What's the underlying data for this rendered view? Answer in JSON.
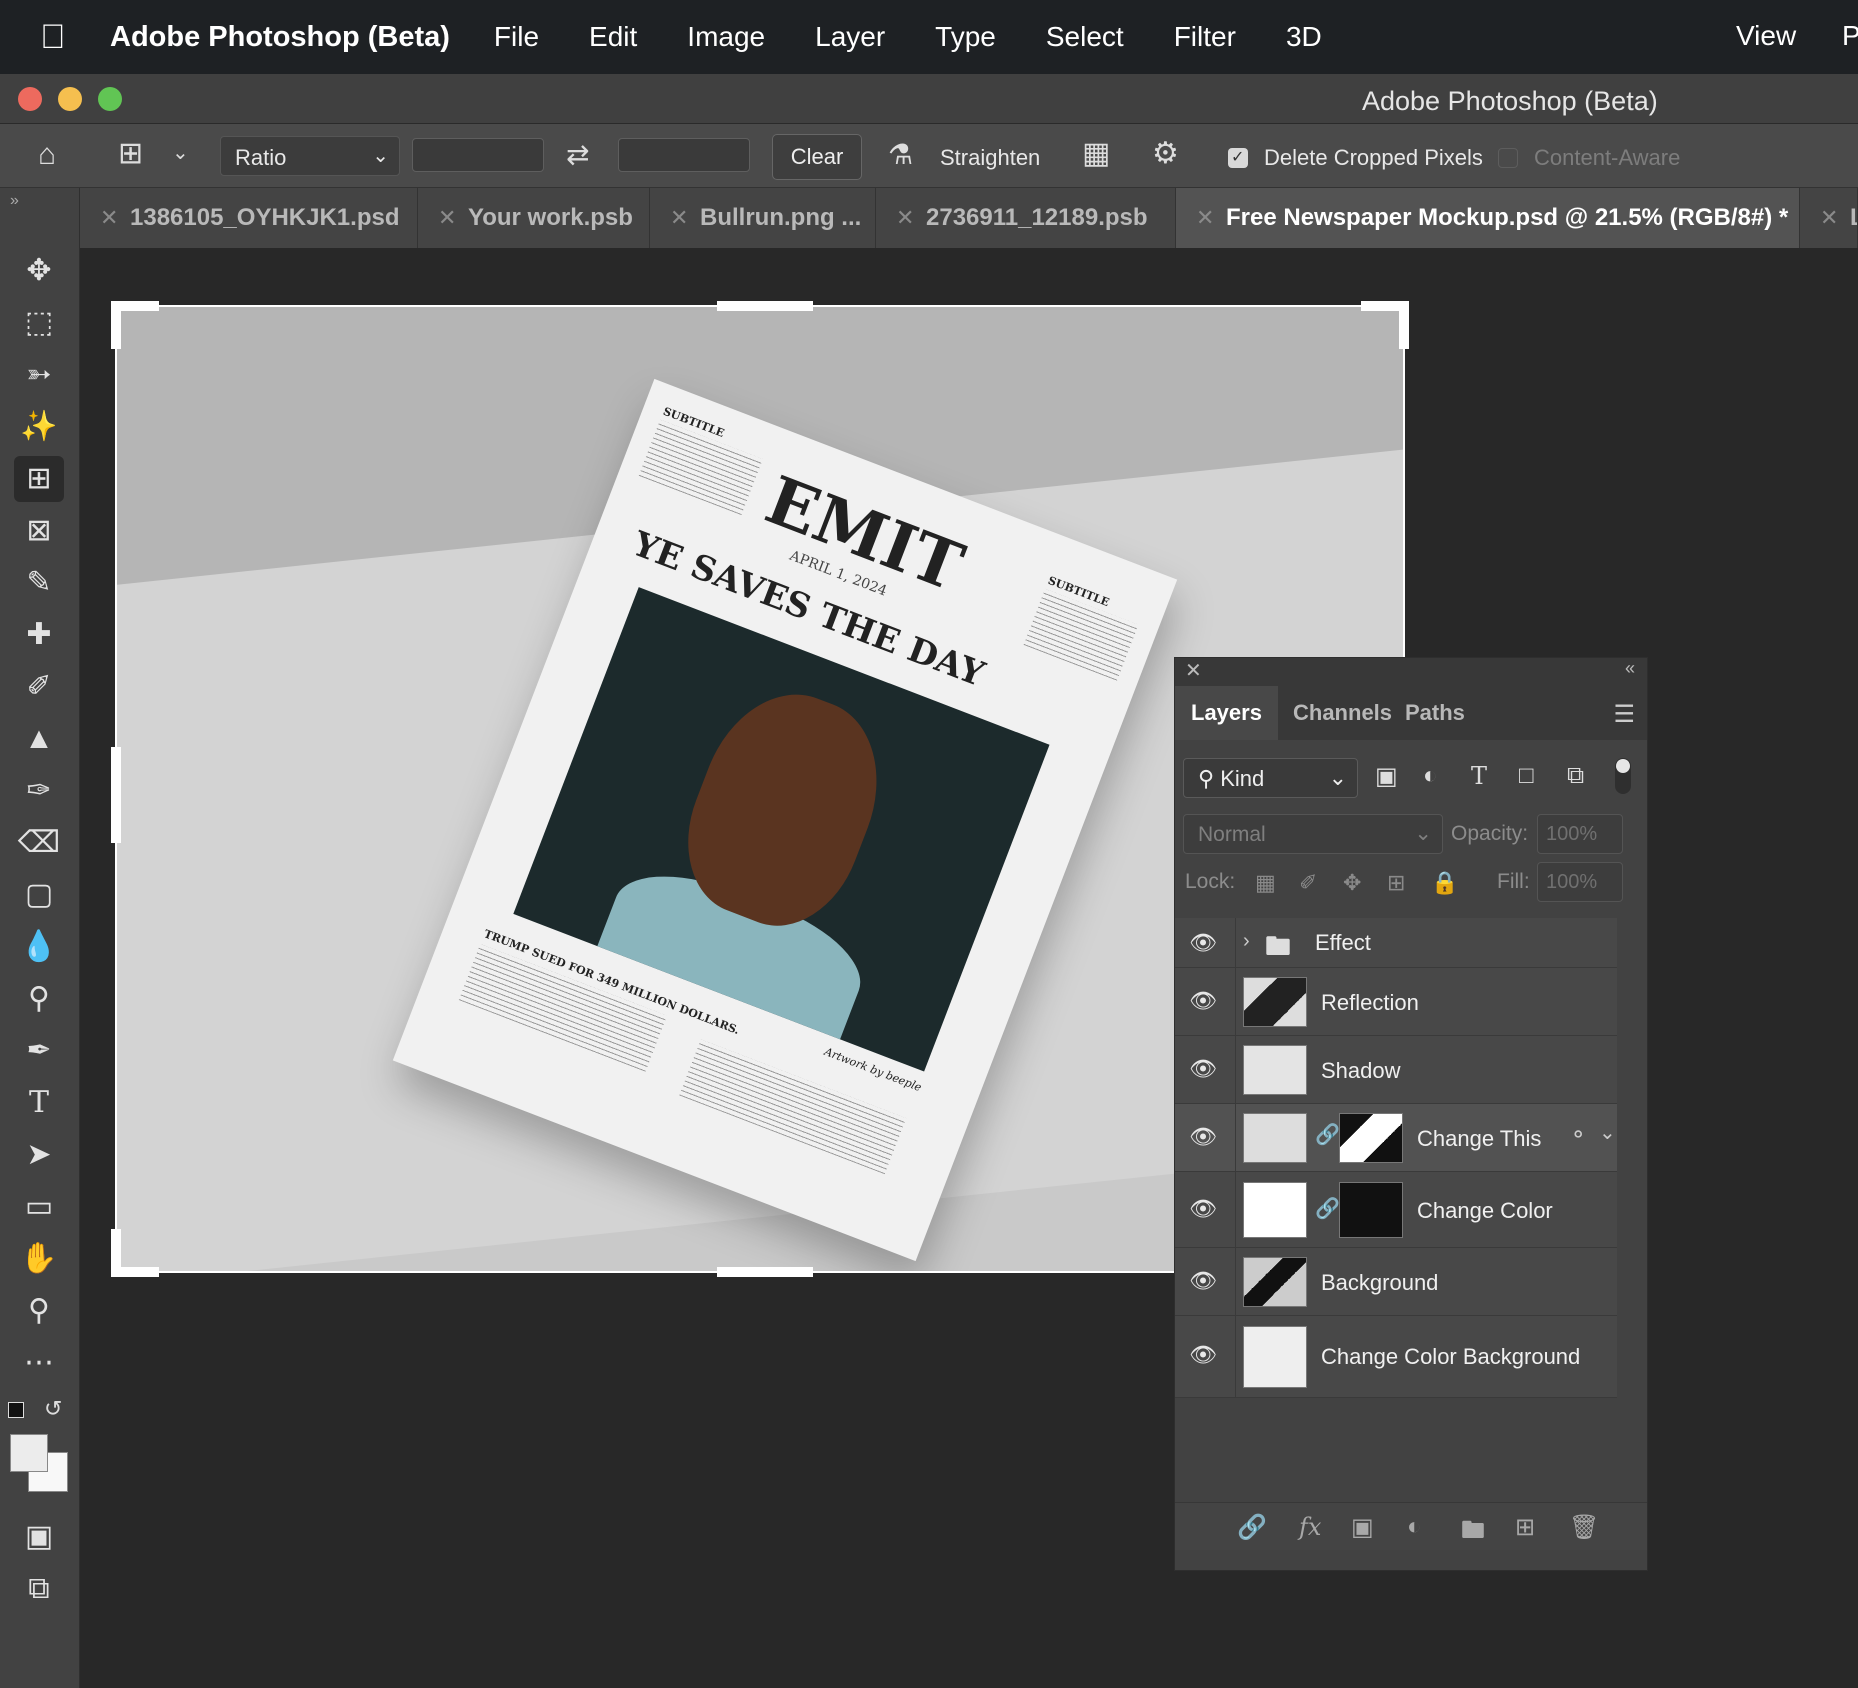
{
  "menubar": {
    "app_name": "Adobe Photoshop (Beta)",
    "menus": [
      "File",
      "Edit",
      "Image",
      "Layer",
      "Type",
      "Select",
      "Filter",
      "3D"
    ],
    "right_menus": [
      "View",
      "P"
    ]
  },
  "window": {
    "title": "Adobe Photoshop (Beta)"
  },
  "options_bar": {
    "ratio_value": "Ratio",
    "clear_label": "Clear",
    "straighten_label": "Straighten",
    "delete_cropped_label": "Delete Cropped Pixels",
    "delete_cropped_checked": true,
    "content_aware_label": "Content-Aware",
    "content_aware_checked": false
  },
  "tabs": [
    {
      "label": "1386105_OYHKJK1.psd",
      "active": false
    },
    {
      "label": "Your work.psb",
      "active": false
    },
    {
      "label": "Bullrun.png ...",
      "active": false
    },
    {
      "label": "2736911_12189.psb",
      "active": false
    },
    {
      "label": "Free Newspaper Mockup.psd @ 21.5% (RGB/8#) *",
      "active": true
    },
    {
      "label": "L",
      "active": false
    }
  ],
  "tools": [
    "move-tool",
    "marquee-tool",
    "lasso-tool",
    "magic-wand-tool",
    "crop-tool",
    "frame-tool",
    "eyedropper-tool",
    "healing-brush-tool",
    "brush-tool",
    "clone-stamp-tool",
    "history-brush-tool",
    "eraser-tool",
    "gradient-tool",
    "blur-tool",
    "dodge-tool",
    "pen-tool",
    "type-tool",
    "path-selection-tool",
    "rectangle-tool",
    "hand-tool",
    "zoom-tool",
    "more-tools"
  ],
  "newspaper": {
    "masthead": "EMIT",
    "date": "APRIL 1, 2024",
    "headline": "YE SAVES THE DAY",
    "subtitle_left": "SUBTITLE",
    "subtitle_right": "SUBTITLE",
    "sub_story": "TRUMP SUED FOR 349 MILLION DOLLARS.",
    "credit": "Artwork by beeple"
  },
  "layers_panel": {
    "tabs": [
      "Layers",
      "Channels",
      "Paths"
    ],
    "active_tab": "Layers",
    "filter_kind": "Kind",
    "blend_mode": "Normal",
    "opacity_label": "Opacity:",
    "opacity_value": "100%",
    "lock_label": "Lock:",
    "fill_label": "Fill:",
    "fill_value": "100%",
    "layers": [
      {
        "name": "Effect",
        "type": "group"
      },
      {
        "name": "Reflection",
        "type": "layer"
      },
      {
        "name": "Shadow",
        "type": "layer"
      },
      {
        "name": "Change This",
        "type": "smart-object-masked"
      },
      {
        "name": "Change Color",
        "type": "fill-masked"
      },
      {
        "name": "Background",
        "type": "layer"
      },
      {
        "name": "Change Color Background",
        "type": "fill"
      }
    ]
  },
  "colors": {
    "menubar_bg": "#1e2124",
    "panel_bg": "#424242",
    "canvas_bg": "#282828",
    "close_red": "#ed6a5e",
    "minimize_yellow": "#f5bf4f",
    "zoom_green": "#61c554"
  }
}
